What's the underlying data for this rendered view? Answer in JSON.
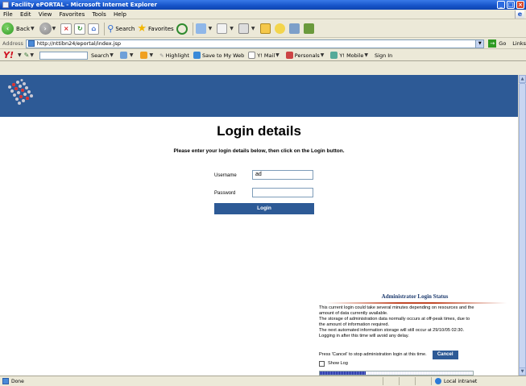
{
  "window": {
    "title": "Facility ePORTAL - Microsoft Internet Explorer",
    "min": "_",
    "max": "□",
    "close": "×"
  },
  "menu": [
    "File",
    "Edit",
    "View",
    "Favorites",
    "Tools",
    "Help"
  ],
  "toolbar": {
    "back_label": "Back",
    "search_label": "Search",
    "favorites_label": "Favorites"
  },
  "address": {
    "label": "Address",
    "url": "http://nttibn24/eportal/index.jsp",
    "go_label": "Go",
    "links_label": "Links"
  },
  "yahoo": {
    "logo": "Y!",
    "search_label": "Search",
    "highlight_label": "Highlight",
    "save_label": "Save to My Web",
    "mail_label": "Y! Mail",
    "personals_label": "Personals",
    "mobile_label": "Y! Mobile",
    "signin_label": "Sign In"
  },
  "login": {
    "title": "Login details",
    "subtitle": "Please enter your login details below, then click on the Login button.",
    "username_label": "Username",
    "username_value": "ad",
    "password_label": "Password",
    "password_value": "",
    "button_label": "Login"
  },
  "admin": {
    "title": "Administrator Login Status",
    "lines": [
      "This current login could take several minutes depending on resources and the",
      "amount of data currently available.",
      "The storage of administration data normally occurs at off-peak times, due to",
      "the amount of information required.",
      "The next automated information storage will still occur at 29/10/05 02:30.",
      "Logging in after this time will avoid any delay."
    ],
    "cancel_prompt": "Press 'Cancel' to stop administration login at this time.",
    "cancel_label": "Cancel",
    "show_log_label": "Show Log",
    "progress_fraction": 0.3
  },
  "status": {
    "text": "Done",
    "zone": "Local intranet"
  }
}
